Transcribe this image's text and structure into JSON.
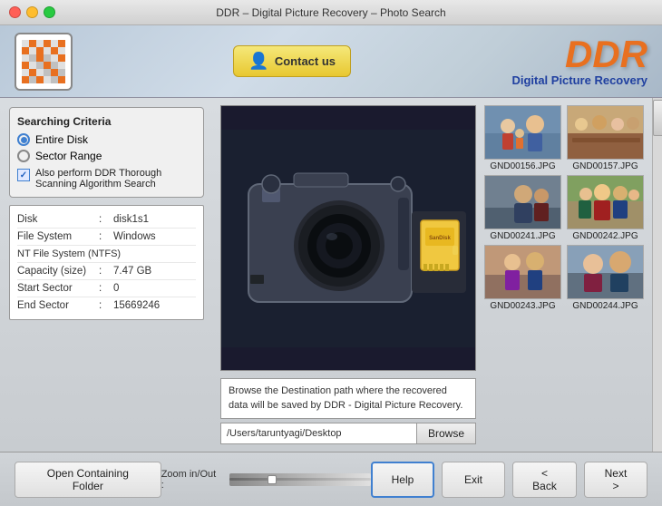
{
  "titlebar": {
    "title": "DDR – Digital Picture Recovery – Photo Search"
  },
  "header": {
    "contact_label": "Contact us",
    "brand_ddr": "DDR",
    "brand_sub": "Digital Picture Recovery"
  },
  "left_panel": {
    "search_criteria_title": "Searching Criteria",
    "option_entire_disk": "Entire Disk",
    "option_sector_range": "Sector Range",
    "algo_check_label": "Also perform DDR Thorough Scanning Algorithm Search",
    "info_rows": [
      {
        "label": "Disk",
        "colon": ":",
        "value": "disk1s1"
      },
      {
        "label": "File System",
        "colon": ":",
        "value": "Windows"
      },
      {
        "label": "NT File System (NTFS)",
        "colon": "",
        "value": ""
      },
      {
        "label": "Capacity (size)",
        "colon": ":",
        "value": "7.47 GB"
      },
      {
        "label": "Start Sector",
        "colon": ":",
        "value": "0"
      },
      {
        "label": "End Sector",
        "colon": ":",
        "value": "15669246"
      }
    ]
  },
  "center_panel": {
    "dest_text": "Browse the Destination path where the recovered data will be saved by DDR - Digital Picture Recovery.",
    "path_value": "/Users/taruntyagi/Desktop",
    "browse_label": "Browse"
  },
  "thumbnails": [
    {
      "label": "GND00156.JPG",
      "color_class": "thumb-people1"
    },
    {
      "label": "GND00157.JPG",
      "color_class": "thumb-people2"
    },
    {
      "label": "GND00241.JPG",
      "color_class": "thumb-people3"
    },
    {
      "label": "GND00242.JPG",
      "color_class": "thumb-people4"
    },
    {
      "label": "GND00243.JPG",
      "color_class": "thumb-people5"
    },
    {
      "label": "GND00244.JPG",
      "color_class": "thumb-people6"
    }
  ],
  "footer": {
    "open_folder_label": "Open Containing Folder",
    "zoom_label": "Zoom in/Out :",
    "help_label": "Help",
    "exit_label": "Exit",
    "back_label": "< Back",
    "next_label": "Next >"
  }
}
